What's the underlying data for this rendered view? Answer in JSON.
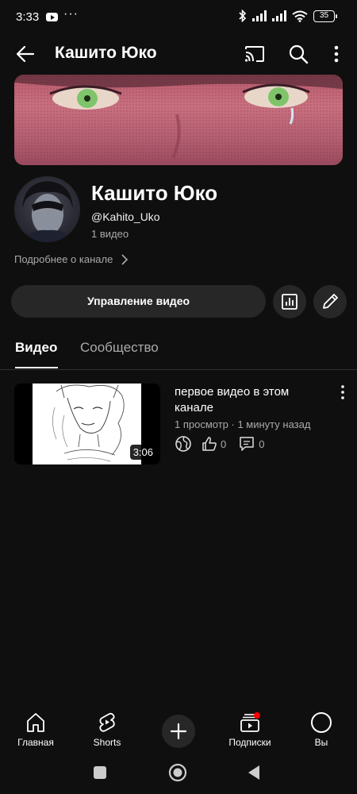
{
  "status_bar": {
    "time": "3:33",
    "dots": "···",
    "battery": "35"
  },
  "app_bar": {
    "title": "Кашито Юко"
  },
  "channel": {
    "name": "Кашито Юко",
    "handle": "@Kahito_Uko",
    "stats": "1 видео",
    "more_about": "Подробнее о канале",
    "manage_label": "Управление видео"
  },
  "tabs": [
    {
      "label": "Видео",
      "active": true
    },
    {
      "label": "Сообщество",
      "active": false
    }
  ],
  "video": {
    "title": "первое видео в этом канале",
    "meta": "1 просмотр · 1 минуту назад",
    "duration": "3:06",
    "likes": "0",
    "comments": "0"
  },
  "bottom_nav": [
    {
      "label": "Главная",
      "icon": "home-icon"
    },
    {
      "label": "Shorts",
      "icon": "shorts-icon"
    },
    {
      "label": "",
      "icon": "create-icon"
    },
    {
      "label": "Подписки",
      "icon": "subscriptions-icon"
    },
    {
      "label": "Вы",
      "icon": "you-icon"
    }
  ],
  "colors": {
    "background": "#0f0f0f",
    "surface": "#272727",
    "text": "#f1f1f1",
    "muted": "#aaaaaa",
    "notification": "#ff0000"
  }
}
